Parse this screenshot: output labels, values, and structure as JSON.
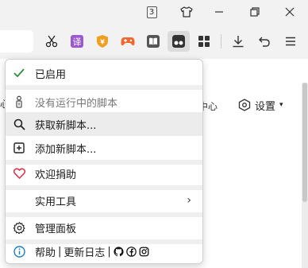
{
  "titlebar": {
    "tab_count": "3"
  },
  "page": {
    "snippet_1": "心",
    "snippet_2": "中心",
    "settings_label": "设置",
    "settings_caret": "▾"
  },
  "menu": {
    "enabled_label": "已启用",
    "no_scripts_label": "没有运行中的脚本",
    "get_scripts_label": "获取新脚本...",
    "add_script_label": "添加新脚本...",
    "donate_label": "欢迎捐助",
    "tools_label": "实用工具",
    "tools_chevron": "›",
    "dashboard_label": "管理面板",
    "help_label": "帮助",
    "pipe_1": "|",
    "changelog_label": "更新日志",
    "pipe_2": "|"
  },
  "colors": {
    "check_green": "#2e8b3e",
    "heart_red": "#d9334a",
    "info_blue": "#1e7fc0",
    "translate_purple": "#9b59d0",
    "shield_orange": "#f0a020",
    "gamepad_orange": "#f06a30"
  },
  "icons": {
    "toolbar": [
      "scissors-icon",
      "translate-icon",
      "shield-icon",
      "gamepad-icon",
      "reader-icon",
      "tampermonkey-icon",
      "apps-grid-icon",
      "download-icon",
      "undo-icon",
      "menu-icon"
    ],
    "menu": [
      "check-icon",
      "script-icon",
      "search-icon",
      "plus-box-icon",
      "heart-icon",
      "gear-icon",
      "info-icon",
      "github-icon",
      "facebook-icon",
      "instagram-icon"
    ]
  }
}
